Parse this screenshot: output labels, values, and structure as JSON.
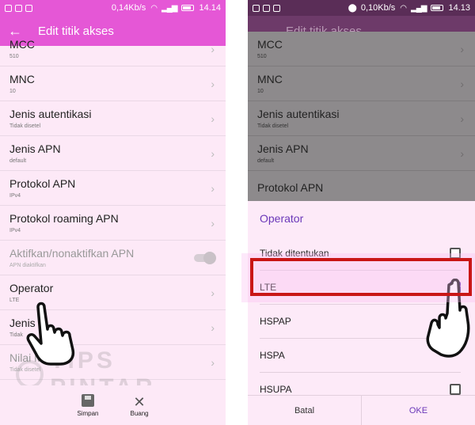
{
  "left": {
    "status": {
      "speed": "0,14Kb/s",
      "time": "14.14"
    },
    "header": {
      "back_icon": "arrow-left-icon",
      "title": "Edit titik akses"
    },
    "rows": [
      {
        "title": "MCC",
        "value": "510"
      },
      {
        "title": "MNC",
        "value": "10"
      },
      {
        "title": "Jenis autentikasi",
        "value": "Tidak disetel"
      },
      {
        "title": "Jenis APN",
        "value": "default"
      },
      {
        "title": "Protokol APN",
        "value": "IPv4"
      },
      {
        "title": "Protokol roaming APN",
        "value": "IPv4"
      },
      {
        "title": "Aktifkan/nonaktifkan APN",
        "value": "APN diaktifkan"
      },
      {
        "title": "Operator",
        "value": "LTE"
      },
      {
        "title": "Jenis",
        "value": "Tidak"
      },
      {
        "title": "Nilai M",
        "value": "Tidak disetel"
      }
    ],
    "bottom": {
      "save_label": "Simpan",
      "discard_label": "Buang"
    }
  },
  "right": {
    "status": {
      "speed": "0,10Kb/s",
      "time": "14.13"
    },
    "header": {
      "back_icon": "arrow-left-icon",
      "title": "Edit titik akses"
    },
    "rows": [
      {
        "title": "MCC",
        "value": "510"
      },
      {
        "title": "MNC",
        "value": "10"
      },
      {
        "title": "Jenis autentikasi",
        "value": "Tidak disetel"
      },
      {
        "title": "Jenis APN",
        "value": "default"
      },
      {
        "title": "Protokol APN",
        "value": ""
      }
    ],
    "dialog": {
      "title": "Operator",
      "options": [
        {
          "label": "Tidak ditentukan",
          "checked": false
        },
        {
          "label": "LTE",
          "checked": true
        },
        {
          "label": "HSPAP",
          "checked": null
        },
        {
          "label": "HSPA",
          "checked": null
        },
        {
          "label": "HSUPA",
          "checked": false
        }
      ],
      "cancel_label": "Batal",
      "ok_label": "OKE"
    }
  },
  "watermark": "TIPS PINTAR",
  "colors": {
    "accent": "#e557d6",
    "dialog_accent": "#6a37b8",
    "highlight": "#c91616"
  }
}
